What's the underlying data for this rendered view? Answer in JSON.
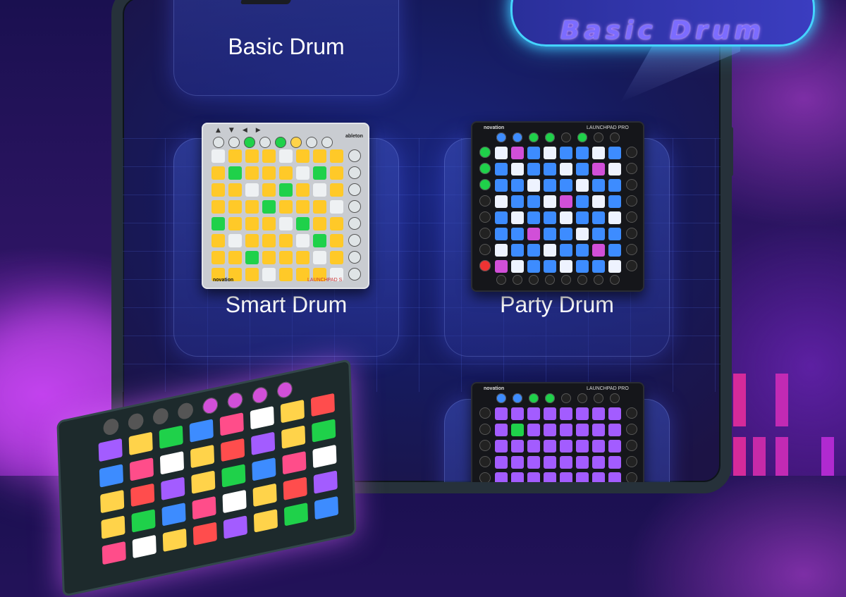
{
  "banner": {
    "title": "Basic Drum"
  },
  "cards": {
    "basic": {
      "label": "Basic Drum"
    },
    "smart": {
      "label": "Smart Drum"
    },
    "party": {
      "label": "Party Drum"
    }
  },
  "devices": {
    "smart": {
      "brand": "novation",
      "model": "LAUNCHPAD S",
      "logo": "ableton"
    },
    "party": {
      "brand": "novation",
      "model": "LAUNCHPAD PRO"
    },
    "bottom": {
      "brand": "novation",
      "model": "LAUNCHPAD PRO"
    }
  },
  "colors": {
    "accent_glow": "#45d4ff",
    "card_bg": "#3a4fbf",
    "pad_yellow": "#ffc928",
    "pad_green": "#1fd14a",
    "pad_blue": "#3d8cff",
    "pad_pink": "#d14fd8",
    "pad_purple": "#a35cff"
  },
  "icons": [
    "drum-pad-icon"
  ]
}
